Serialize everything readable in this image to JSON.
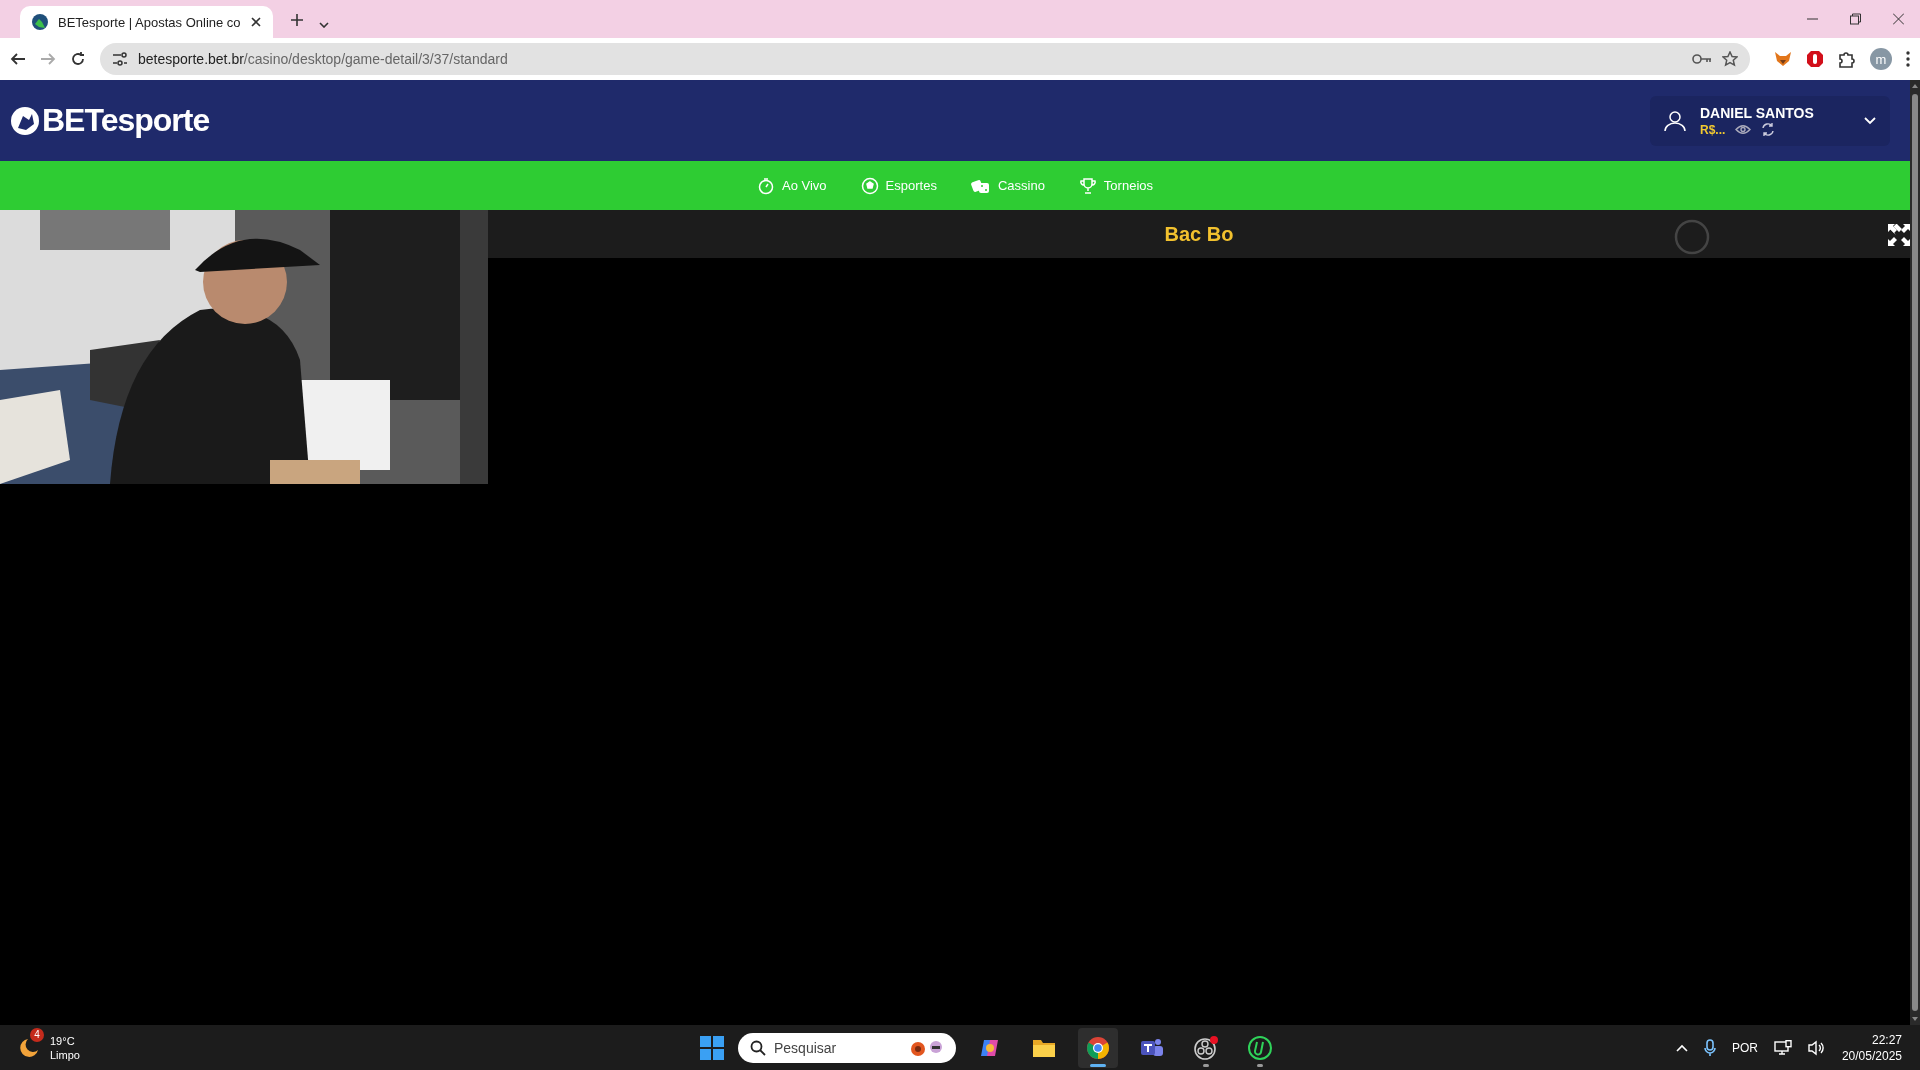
{
  "browser": {
    "tab_title": "BETesporte | Apostas Online co",
    "url_host": "betesporte.bet.br",
    "url_path": "/casino/desktop/game-detail/3/37/standard",
    "profile_initial": "m"
  },
  "site": {
    "logo": "BETesporte",
    "user": {
      "name": "DANIEL SANTOS",
      "balance": "R$..."
    },
    "nav": [
      {
        "label": "Ao Vivo",
        "kind": "stopwatch"
      },
      {
        "label": "Esportes",
        "kind": "ball"
      },
      {
        "label": "Cassino",
        "kind": "dice"
      },
      {
        "label": "Torneios",
        "kind": "trophy"
      }
    ]
  },
  "game": {
    "title": "Bac Bo",
    "loading": true
  },
  "taskbar": {
    "weather": {
      "badge": "4",
      "temperature": "19°C",
      "condition": "Limpo"
    },
    "search": {
      "placeholder": "Pesquisar"
    },
    "apps": [
      {
        "kind": "copilot",
        "active": false,
        "running": false
      },
      {
        "kind": "folder",
        "active": false,
        "running": false
      },
      {
        "kind": "chrome",
        "active": true,
        "running": true
      },
      {
        "kind": "teams",
        "active": false,
        "running": false
      },
      {
        "kind": "obs",
        "active": false,
        "running": true
      },
      {
        "kind": "u",
        "active": false,
        "running": true
      }
    ],
    "language": "POR",
    "time": "22:27",
    "date": "20/05/2025"
  }
}
